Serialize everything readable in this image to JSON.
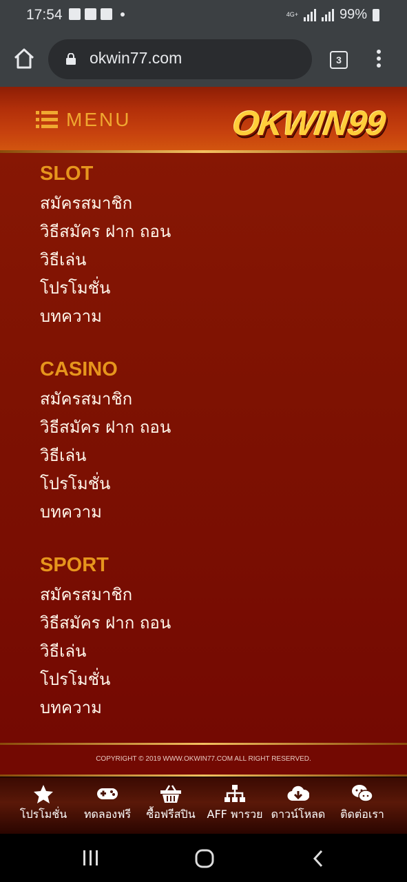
{
  "status_bar": {
    "time": "17:54",
    "network": "4G+",
    "battery": "99%"
  },
  "browser": {
    "url": "okwin77.com",
    "tab_count": "3"
  },
  "header": {
    "menu_label": "MENU",
    "logo_text": "OKWIN99"
  },
  "sections": [
    {
      "title": "SLOT",
      "links": [
        "สมัครสมาชิก",
        "วิธีสมัคร ฝาก ถอน",
        "วิธีเล่น",
        "โปรโมชั่น",
        "บทความ"
      ]
    },
    {
      "title": "CASINO",
      "links": [
        "สมัครสมาชิก",
        "วิธีสมัคร ฝาก ถอน",
        "วิธีเล่น",
        "โปรโมชั่น",
        "บทความ"
      ]
    },
    {
      "title": "SPORT",
      "links": [
        "สมัครสมาชิก",
        "วิธีสมัคร ฝาก ถอน",
        "วิธีเล่น",
        "โปรโมชั่น",
        "บทความ"
      ]
    }
  ],
  "footer": {
    "copyright": "COPYRIGHT © 2019 WWW.OKWIN77.COM ALL RIGHT RESERVED."
  },
  "bottom_nav": [
    {
      "label": "โปรโมชั่น",
      "icon": "star-icon"
    },
    {
      "label": "ทดลองฟรี",
      "icon": "gamepad-icon"
    },
    {
      "label": "ซื้อฟรีสปิน",
      "icon": "basket-icon"
    },
    {
      "label": "AFF พารวย",
      "icon": "sitemap-icon"
    },
    {
      "label": "ดาวน์โหลด",
      "icon": "cloud-download-icon"
    },
    {
      "label": "ติดต่อเรา",
      "icon": "chat-icon"
    }
  ],
  "colors": {
    "accent_gold": "#e6951d",
    "background_red": "#7e1202",
    "text": "#fff6ea"
  }
}
